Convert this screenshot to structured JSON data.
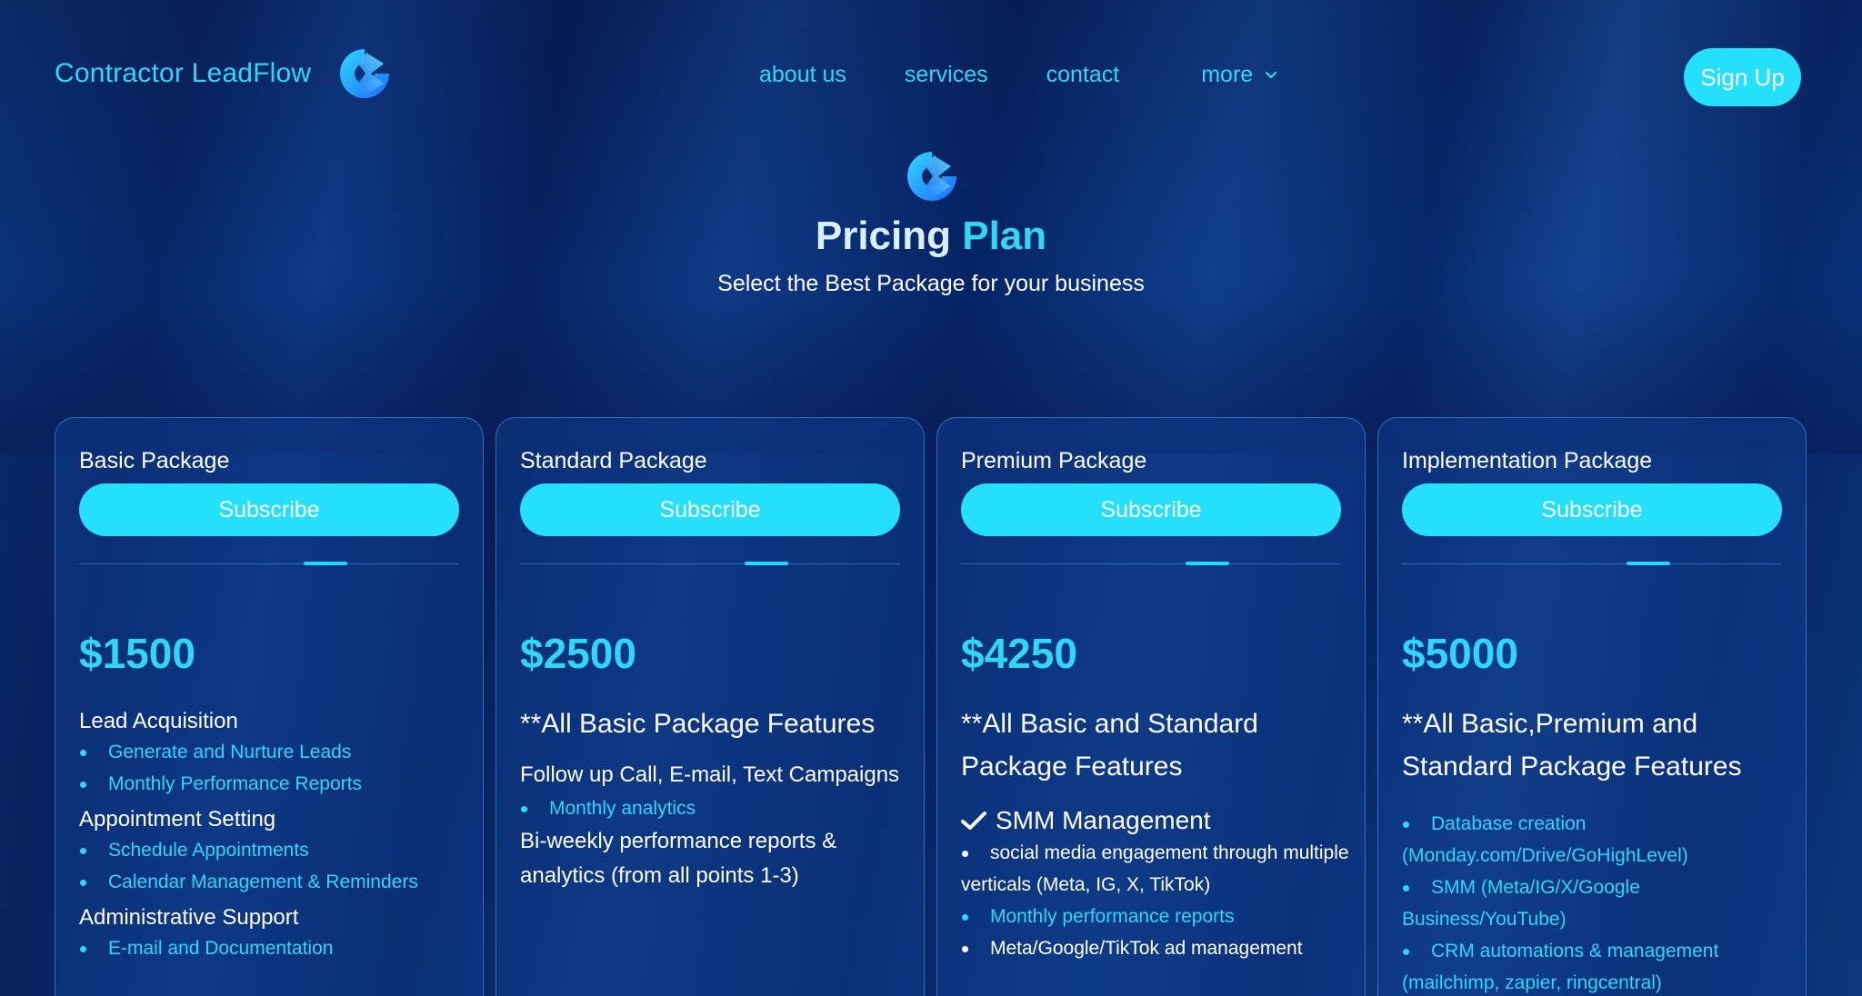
{
  "header": {
    "brand": "Contractor LeadFlow",
    "nav": {
      "about": "about us",
      "services": "services",
      "contact": "contact",
      "more": "more"
    },
    "signup": "Sign Up"
  },
  "hero": {
    "title_part1": "Pricing",
    "title_part2": "Plan",
    "subtitle": "Select the Best Package for your business"
  },
  "cards": [
    {
      "title": "Basic Package",
      "subscribe": "Subscribe",
      "price": "$1500",
      "sections": [
        {
          "heading": "Lead Acquisition",
          "items": [
            "Generate and Nurture Leads",
            "Monthly Performance Reports"
          ]
        },
        {
          "heading": "Appointment Setting",
          "items": [
            "Schedule Appointments",
            "Calendar Management & Reminders"
          ]
        },
        {
          "heading": "Administrative Support",
          "items": [
            "E-mail and Documentation"
          ]
        }
      ]
    },
    {
      "title": "Standard Package",
      "subscribe": "Subscribe",
      "price": "$2500",
      "feature_header": "**All Basic Package Features",
      "heading1": "Follow up Call, E-mail, Text Campaigns",
      "items1": [
        "Monthly analytics"
      ],
      "heading2": "Bi-weekly performance reports & analytics (from all points 1-3)"
    },
    {
      "title": "Premium Package",
      "subscribe": "Subscribe",
      "price": "$4250",
      "feature_header": "**All Basic and Standard Package Features",
      "check_heading": "SMM Management",
      "items": [
        "social media engagement through multiple verticals (Meta, IG, X, TikTok)",
        "Monthly performance reports",
        "Meta/Google/TikTok ad management"
      ]
    },
    {
      "title": "Implementation Package",
      "subscribe": "Subscribe",
      "price": "$5000",
      "feature_header": "**All Basic,Premium and Standard Package Features",
      "items": [
        "Database creation (Monday.com/Drive/GoHighLevel)",
        "SMM (Meta/IG/X/Google Business/YouTube)",
        "CRM automations & management (mailchimp, zapier, ringcentral)"
      ]
    }
  ],
  "colors": {
    "accent": "#25e0fb",
    "accent_text": "#32d6f5",
    "background": "#0a2f6e"
  }
}
